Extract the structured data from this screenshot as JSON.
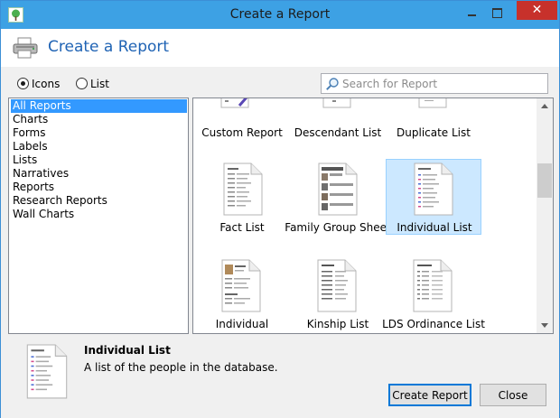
{
  "window": {
    "title": "Create a Report"
  },
  "header": {
    "title": "Create a Report"
  },
  "view_options": {
    "icons_label": "Icons",
    "list_label": "List",
    "selected": "Icons"
  },
  "search": {
    "placeholder": "Search for Report",
    "value": ""
  },
  "categories": [
    {
      "label": "All Reports",
      "selected": true
    },
    {
      "label": "Charts"
    },
    {
      "label": "Forms"
    },
    {
      "label": "Labels"
    },
    {
      "label": "Lists"
    },
    {
      "label": "Narratives"
    },
    {
      "label": "Reports"
    },
    {
      "label": "Research Reports"
    },
    {
      "label": "Wall Charts"
    }
  ],
  "reports": [
    {
      "label": "Custom Report",
      "icon": "custom-report-icon"
    },
    {
      "label": "Descendant List",
      "icon": "descendant-list-icon"
    },
    {
      "label": "Duplicate List",
      "icon": "duplicate-list-icon"
    },
    {
      "label": "Fact List",
      "icon": "fact-list-icon"
    },
    {
      "label": "Family Group Sheet",
      "icon": "family-group-sheet-icon"
    },
    {
      "label": "Individual List",
      "icon": "individual-list-icon",
      "selected": true
    },
    {
      "label": "Individual",
      "icon": "individual-report-icon"
    },
    {
      "label": "Kinship List",
      "icon": "kinship-list-icon"
    },
    {
      "label": "LDS Ordinance List",
      "icon": "lds-ordinance-list-icon"
    }
  ],
  "detail": {
    "title": "Individual List",
    "description": "A list of the people in the database."
  },
  "buttons": {
    "create": "Create Report",
    "close": "Close"
  },
  "colors": {
    "accent": "#3da1e4",
    "selection": "#3399ff",
    "tile_selection": "#cce8ff",
    "header_title": "#1f63b4"
  }
}
